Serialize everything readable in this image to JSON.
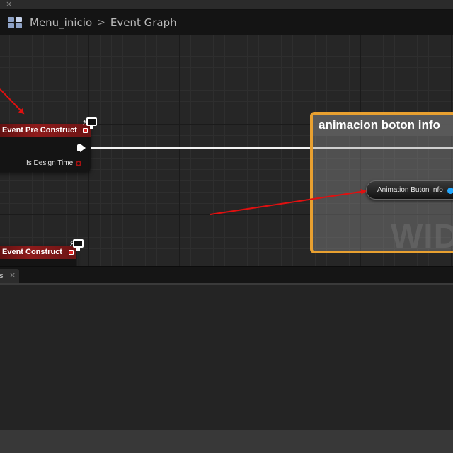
{
  "top_strip": {
    "close_glyph": "×"
  },
  "breadcrumb": {
    "icon": "blueprint-icon",
    "asset": "Menu_inicio",
    "separator": ">",
    "graph": "Event Graph"
  },
  "graph": {
    "nodes": {
      "event_pre_construct": {
        "title": "Event Pre Construct",
        "pins": {
          "is_design_time": "Is Design Time"
        },
        "icon": "widget-event-icon"
      },
      "event_construct": {
        "title": "Event Construct",
        "icon": "widget-event-icon"
      }
    },
    "comment": {
      "title": "animacion boton info"
    },
    "variable_node": {
      "label": "Animation Buton Info"
    },
    "watermark": "WIDGET",
    "accent_colors": {
      "event_header": "#8e1b1b",
      "comment_border": "#e8a030",
      "object_pin": "#23a8ff",
      "annotation_arrow": "#e01010"
    }
  },
  "bottom_panel": {
    "tab_label": "s",
    "tab_close": "×"
  }
}
